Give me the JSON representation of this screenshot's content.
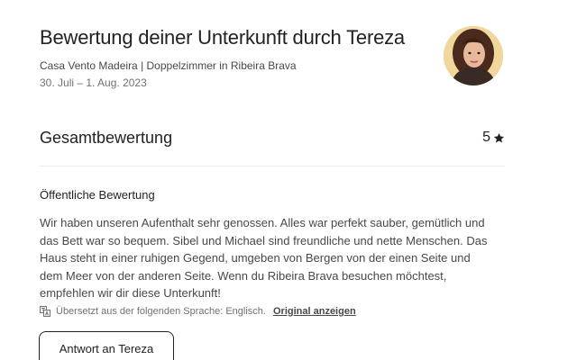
{
  "header": {
    "title": "Bewertung deiner Unterkunft durch Tereza",
    "listing": "Casa Vento Madeira | Doppelzimmer in Ribeira Brava",
    "dates": "30. Juli – 1. Aug. 2023"
  },
  "overall": {
    "label": "Gesamtbewertung",
    "score": "5",
    "icon": "star-icon"
  },
  "public_review": {
    "title": "Öffentliche Bewertung",
    "lines": [
      "Wir haben unseren Aufenthalt sehr genossen. Alles war perfekt sauber, gemütlich und",
      "das Bett war so bequem. Sibel und Michael sind freundliche und nette Menschen. Das",
      "Haus steht in einer ruhigen Gegend, umgeben von Bergen von der einen Seite und",
      "dem Meer von der anderen Seite. Wenn du Ribeira Brava besuchen möchtest,",
      "empfehlen wir dir diese Unterkunft!"
    ],
    "translation_note": "Übersetzt aus der folgenden Sprache: Englisch.",
    "original_link": "Original anzeigen",
    "translation_icon": "translate-icon"
  },
  "reply_button": {
    "label": "Antwort an Tereza"
  },
  "colors": {
    "text_primary": "#222222",
    "text_secondary": "#717171",
    "divider": "#ebebeb"
  }
}
